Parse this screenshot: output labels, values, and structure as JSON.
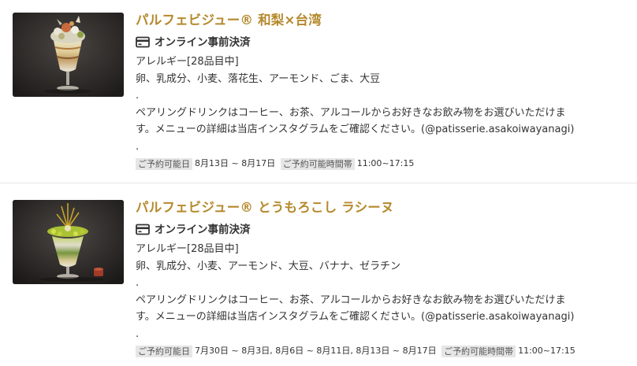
{
  "menu_items": [
    {
      "title": "パルフェビジュー® 和梨×台湾",
      "payment_label": "オンライン事前決済",
      "payment_icon": "credit-card-icon",
      "allergy_heading": "アレルギー[28品目中]",
      "allergens": "卵、乳成分、小麦、落花生、アーモンド、ごま、大豆",
      "separator_1": ".",
      "pairing_line_1": "ペアリングドリンクはコーヒー、お茶、アルコールからお好きなお飲み物をお選びいただけま",
      "pairing_line_2": "す。メニューの詳細は当店インスタグラムをご確認ください。(@patisserie.asakoiwayanagi)",
      "separator_2": ".",
      "date_tag": "ご予約可能日",
      "date_value": "8月13日 ~ 8月17日",
      "time_tag": "ご予約可能時間帯",
      "time_value": "11:00~17:15"
    },
    {
      "title": "パルフェビジュー® とうもろこし ラシーヌ",
      "payment_label": "オンライン事前決済",
      "payment_icon": "credit-card-icon",
      "allergy_heading": "アレルギー[28品目中]",
      "allergens": "卵、乳成分、小麦、アーモンド、大豆、バナナ、ゼラチン",
      "separator_1": ".",
      "pairing_line_1": "ペアリングドリンクはコーヒー、お茶、アルコールからお好きなお飲み物をお選びいただけま",
      "pairing_line_2": "す。メニューの詳細は当店インスタグラムをご確認ください。(@patisserie.asakoiwayanagi)",
      "separator_2": ".",
      "date_tag": "ご予約可能日",
      "date_value": "7月30日 ~ 8月3日, 8月6日 ~ 8月11日, 8月13日 ~ 8月17日",
      "time_tag": "ご予約可能時間帯",
      "time_value": "11:00~17:15"
    }
  ],
  "colors": {
    "title": "#b5892c",
    "text": "#333333",
    "tag_background": "#e6e6e6",
    "divider": "#e5e5e5"
  }
}
